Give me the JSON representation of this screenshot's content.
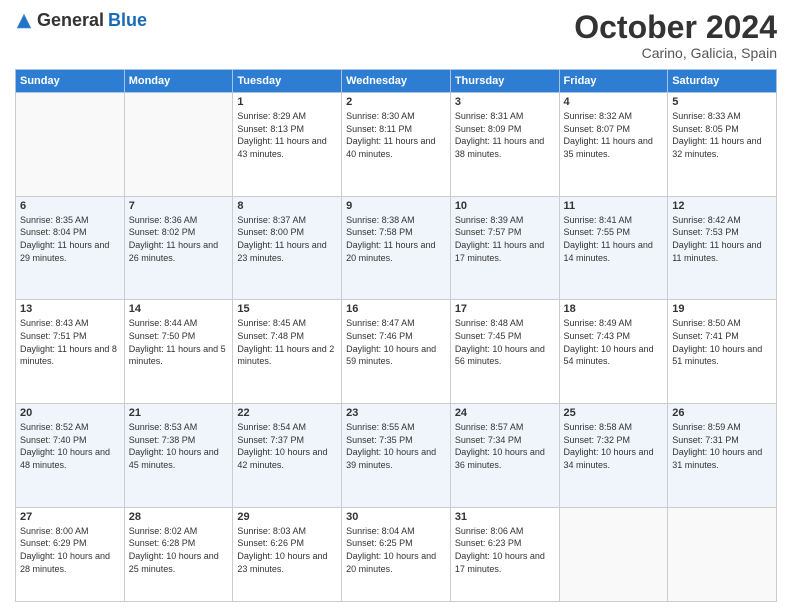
{
  "header": {
    "logo_general": "General",
    "logo_blue": "Blue",
    "month_title": "October 2024",
    "location": "Carino, Galicia, Spain"
  },
  "days_of_week": [
    "Sunday",
    "Monday",
    "Tuesday",
    "Wednesday",
    "Thursday",
    "Friday",
    "Saturday"
  ],
  "weeks": [
    [
      {
        "day": "",
        "sunrise": "",
        "sunset": "",
        "daylight": ""
      },
      {
        "day": "",
        "sunrise": "",
        "sunset": "",
        "daylight": ""
      },
      {
        "day": "1",
        "sunrise": "Sunrise: 8:29 AM",
        "sunset": "Sunset: 8:13 PM",
        "daylight": "Daylight: 11 hours and 43 minutes."
      },
      {
        "day": "2",
        "sunrise": "Sunrise: 8:30 AM",
        "sunset": "Sunset: 8:11 PM",
        "daylight": "Daylight: 11 hours and 40 minutes."
      },
      {
        "day": "3",
        "sunrise": "Sunrise: 8:31 AM",
        "sunset": "Sunset: 8:09 PM",
        "daylight": "Daylight: 11 hours and 38 minutes."
      },
      {
        "day": "4",
        "sunrise": "Sunrise: 8:32 AM",
        "sunset": "Sunset: 8:07 PM",
        "daylight": "Daylight: 11 hours and 35 minutes."
      },
      {
        "day": "5",
        "sunrise": "Sunrise: 8:33 AM",
        "sunset": "Sunset: 8:05 PM",
        "daylight": "Daylight: 11 hours and 32 minutes."
      }
    ],
    [
      {
        "day": "6",
        "sunrise": "Sunrise: 8:35 AM",
        "sunset": "Sunset: 8:04 PM",
        "daylight": "Daylight: 11 hours and 29 minutes."
      },
      {
        "day": "7",
        "sunrise": "Sunrise: 8:36 AM",
        "sunset": "Sunset: 8:02 PM",
        "daylight": "Daylight: 11 hours and 26 minutes."
      },
      {
        "day": "8",
        "sunrise": "Sunrise: 8:37 AM",
        "sunset": "Sunset: 8:00 PM",
        "daylight": "Daylight: 11 hours and 23 minutes."
      },
      {
        "day": "9",
        "sunrise": "Sunrise: 8:38 AM",
        "sunset": "Sunset: 7:58 PM",
        "daylight": "Daylight: 11 hours and 20 minutes."
      },
      {
        "day": "10",
        "sunrise": "Sunrise: 8:39 AM",
        "sunset": "Sunset: 7:57 PM",
        "daylight": "Daylight: 11 hours and 17 minutes."
      },
      {
        "day": "11",
        "sunrise": "Sunrise: 8:41 AM",
        "sunset": "Sunset: 7:55 PM",
        "daylight": "Daylight: 11 hours and 14 minutes."
      },
      {
        "day": "12",
        "sunrise": "Sunrise: 8:42 AM",
        "sunset": "Sunset: 7:53 PM",
        "daylight": "Daylight: 11 hours and 11 minutes."
      }
    ],
    [
      {
        "day": "13",
        "sunrise": "Sunrise: 8:43 AM",
        "sunset": "Sunset: 7:51 PM",
        "daylight": "Daylight: 11 hours and 8 minutes."
      },
      {
        "day": "14",
        "sunrise": "Sunrise: 8:44 AM",
        "sunset": "Sunset: 7:50 PM",
        "daylight": "Daylight: 11 hours and 5 minutes."
      },
      {
        "day": "15",
        "sunrise": "Sunrise: 8:45 AM",
        "sunset": "Sunset: 7:48 PM",
        "daylight": "Daylight: 11 hours and 2 minutes."
      },
      {
        "day": "16",
        "sunrise": "Sunrise: 8:47 AM",
        "sunset": "Sunset: 7:46 PM",
        "daylight": "Daylight: 10 hours and 59 minutes."
      },
      {
        "day": "17",
        "sunrise": "Sunrise: 8:48 AM",
        "sunset": "Sunset: 7:45 PM",
        "daylight": "Daylight: 10 hours and 56 minutes."
      },
      {
        "day": "18",
        "sunrise": "Sunrise: 8:49 AM",
        "sunset": "Sunset: 7:43 PM",
        "daylight": "Daylight: 10 hours and 54 minutes."
      },
      {
        "day": "19",
        "sunrise": "Sunrise: 8:50 AM",
        "sunset": "Sunset: 7:41 PM",
        "daylight": "Daylight: 10 hours and 51 minutes."
      }
    ],
    [
      {
        "day": "20",
        "sunrise": "Sunrise: 8:52 AM",
        "sunset": "Sunset: 7:40 PM",
        "daylight": "Daylight: 10 hours and 48 minutes."
      },
      {
        "day": "21",
        "sunrise": "Sunrise: 8:53 AM",
        "sunset": "Sunset: 7:38 PM",
        "daylight": "Daylight: 10 hours and 45 minutes."
      },
      {
        "day": "22",
        "sunrise": "Sunrise: 8:54 AM",
        "sunset": "Sunset: 7:37 PM",
        "daylight": "Daylight: 10 hours and 42 minutes."
      },
      {
        "day": "23",
        "sunrise": "Sunrise: 8:55 AM",
        "sunset": "Sunset: 7:35 PM",
        "daylight": "Daylight: 10 hours and 39 minutes."
      },
      {
        "day": "24",
        "sunrise": "Sunrise: 8:57 AM",
        "sunset": "Sunset: 7:34 PM",
        "daylight": "Daylight: 10 hours and 36 minutes."
      },
      {
        "day": "25",
        "sunrise": "Sunrise: 8:58 AM",
        "sunset": "Sunset: 7:32 PM",
        "daylight": "Daylight: 10 hours and 34 minutes."
      },
      {
        "day": "26",
        "sunrise": "Sunrise: 8:59 AM",
        "sunset": "Sunset: 7:31 PM",
        "daylight": "Daylight: 10 hours and 31 minutes."
      }
    ],
    [
      {
        "day": "27",
        "sunrise": "Sunrise: 8:00 AM",
        "sunset": "Sunset: 6:29 PM",
        "daylight": "Daylight: 10 hours and 28 minutes."
      },
      {
        "day": "28",
        "sunrise": "Sunrise: 8:02 AM",
        "sunset": "Sunset: 6:28 PM",
        "daylight": "Daylight: 10 hours and 25 minutes."
      },
      {
        "day": "29",
        "sunrise": "Sunrise: 8:03 AM",
        "sunset": "Sunset: 6:26 PM",
        "daylight": "Daylight: 10 hours and 23 minutes."
      },
      {
        "day": "30",
        "sunrise": "Sunrise: 8:04 AM",
        "sunset": "Sunset: 6:25 PM",
        "daylight": "Daylight: 10 hours and 20 minutes."
      },
      {
        "day": "31",
        "sunrise": "Sunrise: 8:06 AM",
        "sunset": "Sunset: 6:23 PM",
        "daylight": "Daylight: 10 hours and 17 minutes."
      },
      {
        "day": "",
        "sunrise": "",
        "sunset": "",
        "daylight": ""
      },
      {
        "day": "",
        "sunrise": "",
        "sunset": "",
        "daylight": ""
      }
    ]
  ]
}
